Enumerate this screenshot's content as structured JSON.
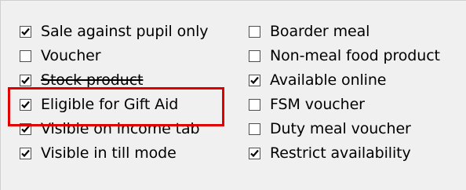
{
  "options": {
    "left": [
      {
        "label": "Sale against pupil only",
        "checked": true
      },
      {
        "label": "Voucher",
        "checked": false
      },
      {
        "label": "Stock product",
        "checked": true
      },
      {
        "label": "Eligible for Gift Aid",
        "checked": true
      },
      {
        "label": "Visible on income tab",
        "checked": true
      },
      {
        "label": "Visible in till mode",
        "checked": true
      }
    ],
    "right": [
      {
        "label": "Boarder meal",
        "checked": false
      },
      {
        "label": "Non-meal food product",
        "checked": false
      },
      {
        "label": "Available online",
        "checked": true
      },
      {
        "label": "FSM voucher",
        "checked": false
      },
      {
        "label": "Duty meal voucher",
        "checked": false
      },
      {
        "label": "Restrict availability",
        "checked": true
      }
    ]
  },
  "colors": {
    "highlight": "#e10000",
    "background": "#f0f0f0"
  }
}
